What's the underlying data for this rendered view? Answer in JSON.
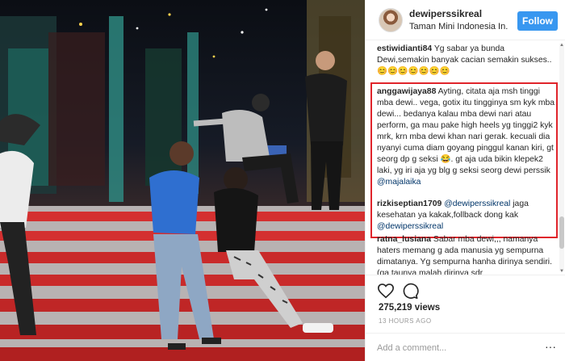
{
  "post": {
    "username": "dewiperssikreal",
    "location": "Taman Mini Indonesia In...",
    "follow_label": "Follow"
  },
  "comments": [
    {
      "user": "estiwidianti84",
      "text": " Yg sabar ya bunda Dewi,semakin banyak cacian semakin sukses..😊😊😊😊😊😊😊"
    },
    {
      "user": "anggawijaya88",
      "text": " Ayting, citata aja msh tinggi mba dewi.. vega, gotix itu tingginya sm kyk mba dewi... bedanya kalau mba dewi nari atau perform, ga mau pake high heels yg tinggi2 kyk mrk, krn mba dewi khan nari gerak. kecuali dia nyanyi cuma diam goyang pinggul kanan kiri, gt seorg dp g seksi 😂. gt aja uda bikin klepek2 laki, yg iri aja yg blg g seksi seorg dewi perssik ",
      "mention": "@majalaika"
    },
    {
      "user": "rizkiseptian1709",
      "mention": "@dewiperssikreal",
      "text": " jaga kesehatan ya kakak,follback dong kak ",
      "mention2": "@dewiperssikreal"
    },
    {
      "user": "ratna_lusiana",
      "text": " Sabar mba dewi,,, namanya haters memang g ada manusia yg sempurna dimatanya. Yg sempurna hanha dirinya sendiri. (ga taunya malah dirinya sdr"
    }
  ],
  "actions": {
    "likes": "275,219 views",
    "timestamp": "13 HOURS AGO"
  },
  "add_comment": {
    "placeholder": "Add a comment..."
  },
  "colors": {
    "follow_button": "#3897f0",
    "highlight_border": "#e0242b",
    "mention": "#003569"
  },
  "icons": [
    "heart-icon",
    "comment-icon",
    "menu-dots-icon"
  ]
}
